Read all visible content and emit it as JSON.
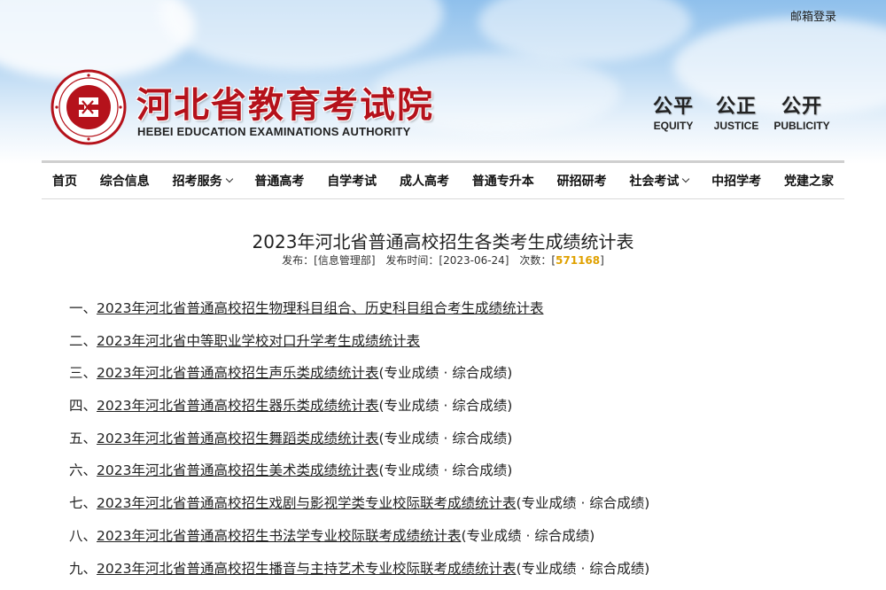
{
  "header": {
    "top_link": "邮箱登录",
    "title": "河北省教育考试院",
    "subtitle": "HEBEI EDUCATION EXAMINATIONS AUTHORITY",
    "motto": [
      {
        "cn": "公平",
        "en": "EQUITY"
      },
      {
        "cn": "公正",
        "en": "JUSTICE"
      },
      {
        "cn": "公开",
        "en": "PUBLICITY"
      }
    ]
  },
  "nav": [
    {
      "label": "首页",
      "dropdown": false
    },
    {
      "label": "综合信息",
      "dropdown": false
    },
    {
      "label": "招考服务",
      "dropdown": true
    },
    {
      "label": "普通高考",
      "dropdown": false
    },
    {
      "label": "自学考试",
      "dropdown": false
    },
    {
      "label": "成人高考",
      "dropdown": false
    },
    {
      "label": "普通专升本",
      "dropdown": false
    },
    {
      "label": "研招研考",
      "dropdown": false
    },
    {
      "label": "社会考试",
      "dropdown": true
    },
    {
      "label": "中招学考",
      "dropdown": false
    },
    {
      "label": "党建之家",
      "dropdown": false
    }
  ],
  "article": {
    "title": "2023年河北省普通高校招生各类考生成绩统计表",
    "publisher_label": "发布：",
    "publisher": "[信息管理部]",
    "time_label": "发布时间：",
    "time": "[2023-06-24]",
    "count_label": "次数：",
    "count_open": "[",
    "count": "571168",
    "count_close": "]"
  },
  "items": [
    {
      "prefix": "一、",
      "link": "2023年河北省普通高校招生物理科目组合、历史科目组合考生成绩统计表",
      "suffix": ""
    },
    {
      "prefix": "二、",
      "link": "2023年河北省中等职业学校对口升学考生成绩统计表",
      "suffix": ""
    },
    {
      "prefix": "三、",
      "link": "2023年河北省普通高校招生声乐类成绩统计表",
      "suffix": "(专业成绩 · 综合成绩)"
    },
    {
      "prefix": "四、",
      "link": "2023年河北省普通高校招生器乐类成绩统计表",
      "suffix": "(专业成绩 · 综合成绩)"
    },
    {
      "prefix": "五、",
      "link": "2023年河北省普通高校招生舞蹈类成绩统计表",
      "suffix": "(专业成绩 · 综合成绩)"
    },
    {
      "prefix": "六、",
      "link": "2023年河北省普通高校招生美术类成绩统计表",
      "suffix": "(专业成绩 · 综合成绩)"
    },
    {
      "prefix": "七、",
      "link": "2023年河北省普通高校招生戏剧与影视学类专业校际联考成绩统计表",
      "suffix": "(专业成绩 · 综合成绩)"
    },
    {
      "prefix": "八、",
      "link": "2023年河北省普通高校招生书法学专业校际联考成绩统计表",
      "suffix": "(专业成绩 · 综合成绩)"
    },
    {
      "prefix": "九、",
      "link": "2023年河北省普通高校招生播音与主持艺术专业校际联考成绩统计表",
      "suffix": "(专业成绩 · 综合成绩)"
    }
  ],
  "colors": {
    "brand_red": "#b5121b",
    "count_orange": "#e0a100"
  }
}
